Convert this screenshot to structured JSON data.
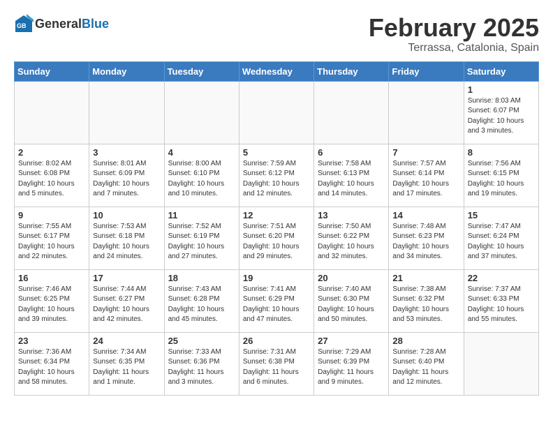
{
  "header": {
    "logo_general": "General",
    "logo_blue": "Blue",
    "title": "February 2025",
    "subtitle": "Terrassa, Catalonia, Spain"
  },
  "weekdays": [
    "Sunday",
    "Monday",
    "Tuesday",
    "Wednesday",
    "Thursday",
    "Friday",
    "Saturday"
  ],
  "weeks": [
    [
      {
        "day": "",
        "info": ""
      },
      {
        "day": "",
        "info": ""
      },
      {
        "day": "",
        "info": ""
      },
      {
        "day": "",
        "info": ""
      },
      {
        "day": "",
        "info": ""
      },
      {
        "day": "",
        "info": ""
      },
      {
        "day": "1",
        "info": "Sunrise: 8:03 AM\nSunset: 6:07 PM\nDaylight: 10 hours\nand 3 minutes."
      }
    ],
    [
      {
        "day": "2",
        "info": "Sunrise: 8:02 AM\nSunset: 6:08 PM\nDaylight: 10 hours\nand 5 minutes."
      },
      {
        "day": "3",
        "info": "Sunrise: 8:01 AM\nSunset: 6:09 PM\nDaylight: 10 hours\nand 7 minutes."
      },
      {
        "day": "4",
        "info": "Sunrise: 8:00 AM\nSunset: 6:10 PM\nDaylight: 10 hours\nand 10 minutes."
      },
      {
        "day": "5",
        "info": "Sunrise: 7:59 AM\nSunset: 6:12 PM\nDaylight: 10 hours\nand 12 minutes."
      },
      {
        "day": "6",
        "info": "Sunrise: 7:58 AM\nSunset: 6:13 PM\nDaylight: 10 hours\nand 14 minutes."
      },
      {
        "day": "7",
        "info": "Sunrise: 7:57 AM\nSunset: 6:14 PM\nDaylight: 10 hours\nand 17 minutes."
      },
      {
        "day": "8",
        "info": "Sunrise: 7:56 AM\nSunset: 6:15 PM\nDaylight: 10 hours\nand 19 minutes."
      }
    ],
    [
      {
        "day": "9",
        "info": "Sunrise: 7:55 AM\nSunset: 6:17 PM\nDaylight: 10 hours\nand 22 minutes."
      },
      {
        "day": "10",
        "info": "Sunrise: 7:53 AM\nSunset: 6:18 PM\nDaylight: 10 hours\nand 24 minutes."
      },
      {
        "day": "11",
        "info": "Sunrise: 7:52 AM\nSunset: 6:19 PM\nDaylight: 10 hours\nand 27 minutes."
      },
      {
        "day": "12",
        "info": "Sunrise: 7:51 AM\nSunset: 6:20 PM\nDaylight: 10 hours\nand 29 minutes."
      },
      {
        "day": "13",
        "info": "Sunrise: 7:50 AM\nSunset: 6:22 PM\nDaylight: 10 hours\nand 32 minutes."
      },
      {
        "day": "14",
        "info": "Sunrise: 7:48 AM\nSunset: 6:23 PM\nDaylight: 10 hours\nand 34 minutes."
      },
      {
        "day": "15",
        "info": "Sunrise: 7:47 AM\nSunset: 6:24 PM\nDaylight: 10 hours\nand 37 minutes."
      }
    ],
    [
      {
        "day": "16",
        "info": "Sunrise: 7:46 AM\nSunset: 6:25 PM\nDaylight: 10 hours\nand 39 minutes."
      },
      {
        "day": "17",
        "info": "Sunrise: 7:44 AM\nSunset: 6:27 PM\nDaylight: 10 hours\nand 42 minutes."
      },
      {
        "day": "18",
        "info": "Sunrise: 7:43 AM\nSunset: 6:28 PM\nDaylight: 10 hours\nand 45 minutes."
      },
      {
        "day": "19",
        "info": "Sunrise: 7:41 AM\nSunset: 6:29 PM\nDaylight: 10 hours\nand 47 minutes."
      },
      {
        "day": "20",
        "info": "Sunrise: 7:40 AM\nSunset: 6:30 PM\nDaylight: 10 hours\nand 50 minutes."
      },
      {
        "day": "21",
        "info": "Sunrise: 7:38 AM\nSunset: 6:32 PM\nDaylight: 10 hours\nand 53 minutes."
      },
      {
        "day": "22",
        "info": "Sunrise: 7:37 AM\nSunset: 6:33 PM\nDaylight: 10 hours\nand 55 minutes."
      }
    ],
    [
      {
        "day": "23",
        "info": "Sunrise: 7:36 AM\nSunset: 6:34 PM\nDaylight: 10 hours\nand 58 minutes."
      },
      {
        "day": "24",
        "info": "Sunrise: 7:34 AM\nSunset: 6:35 PM\nDaylight: 11 hours\nand 1 minute."
      },
      {
        "day": "25",
        "info": "Sunrise: 7:33 AM\nSunset: 6:36 PM\nDaylight: 11 hours\nand 3 minutes."
      },
      {
        "day": "26",
        "info": "Sunrise: 7:31 AM\nSunset: 6:38 PM\nDaylight: 11 hours\nand 6 minutes."
      },
      {
        "day": "27",
        "info": "Sunrise: 7:29 AM\nSunset: 6:39 PM\nDaylight: 11 hours\nand 9 minutes."
      },
      {
        "day": "28",
        "info": "Sunrise: 7:28 AM\nSunset: 6:40 PM\nDaylight: 11 hours\nand 12 minutes."
      },
      {
        "day": "",
        "info": ""
      }
    ]
  ]
}
